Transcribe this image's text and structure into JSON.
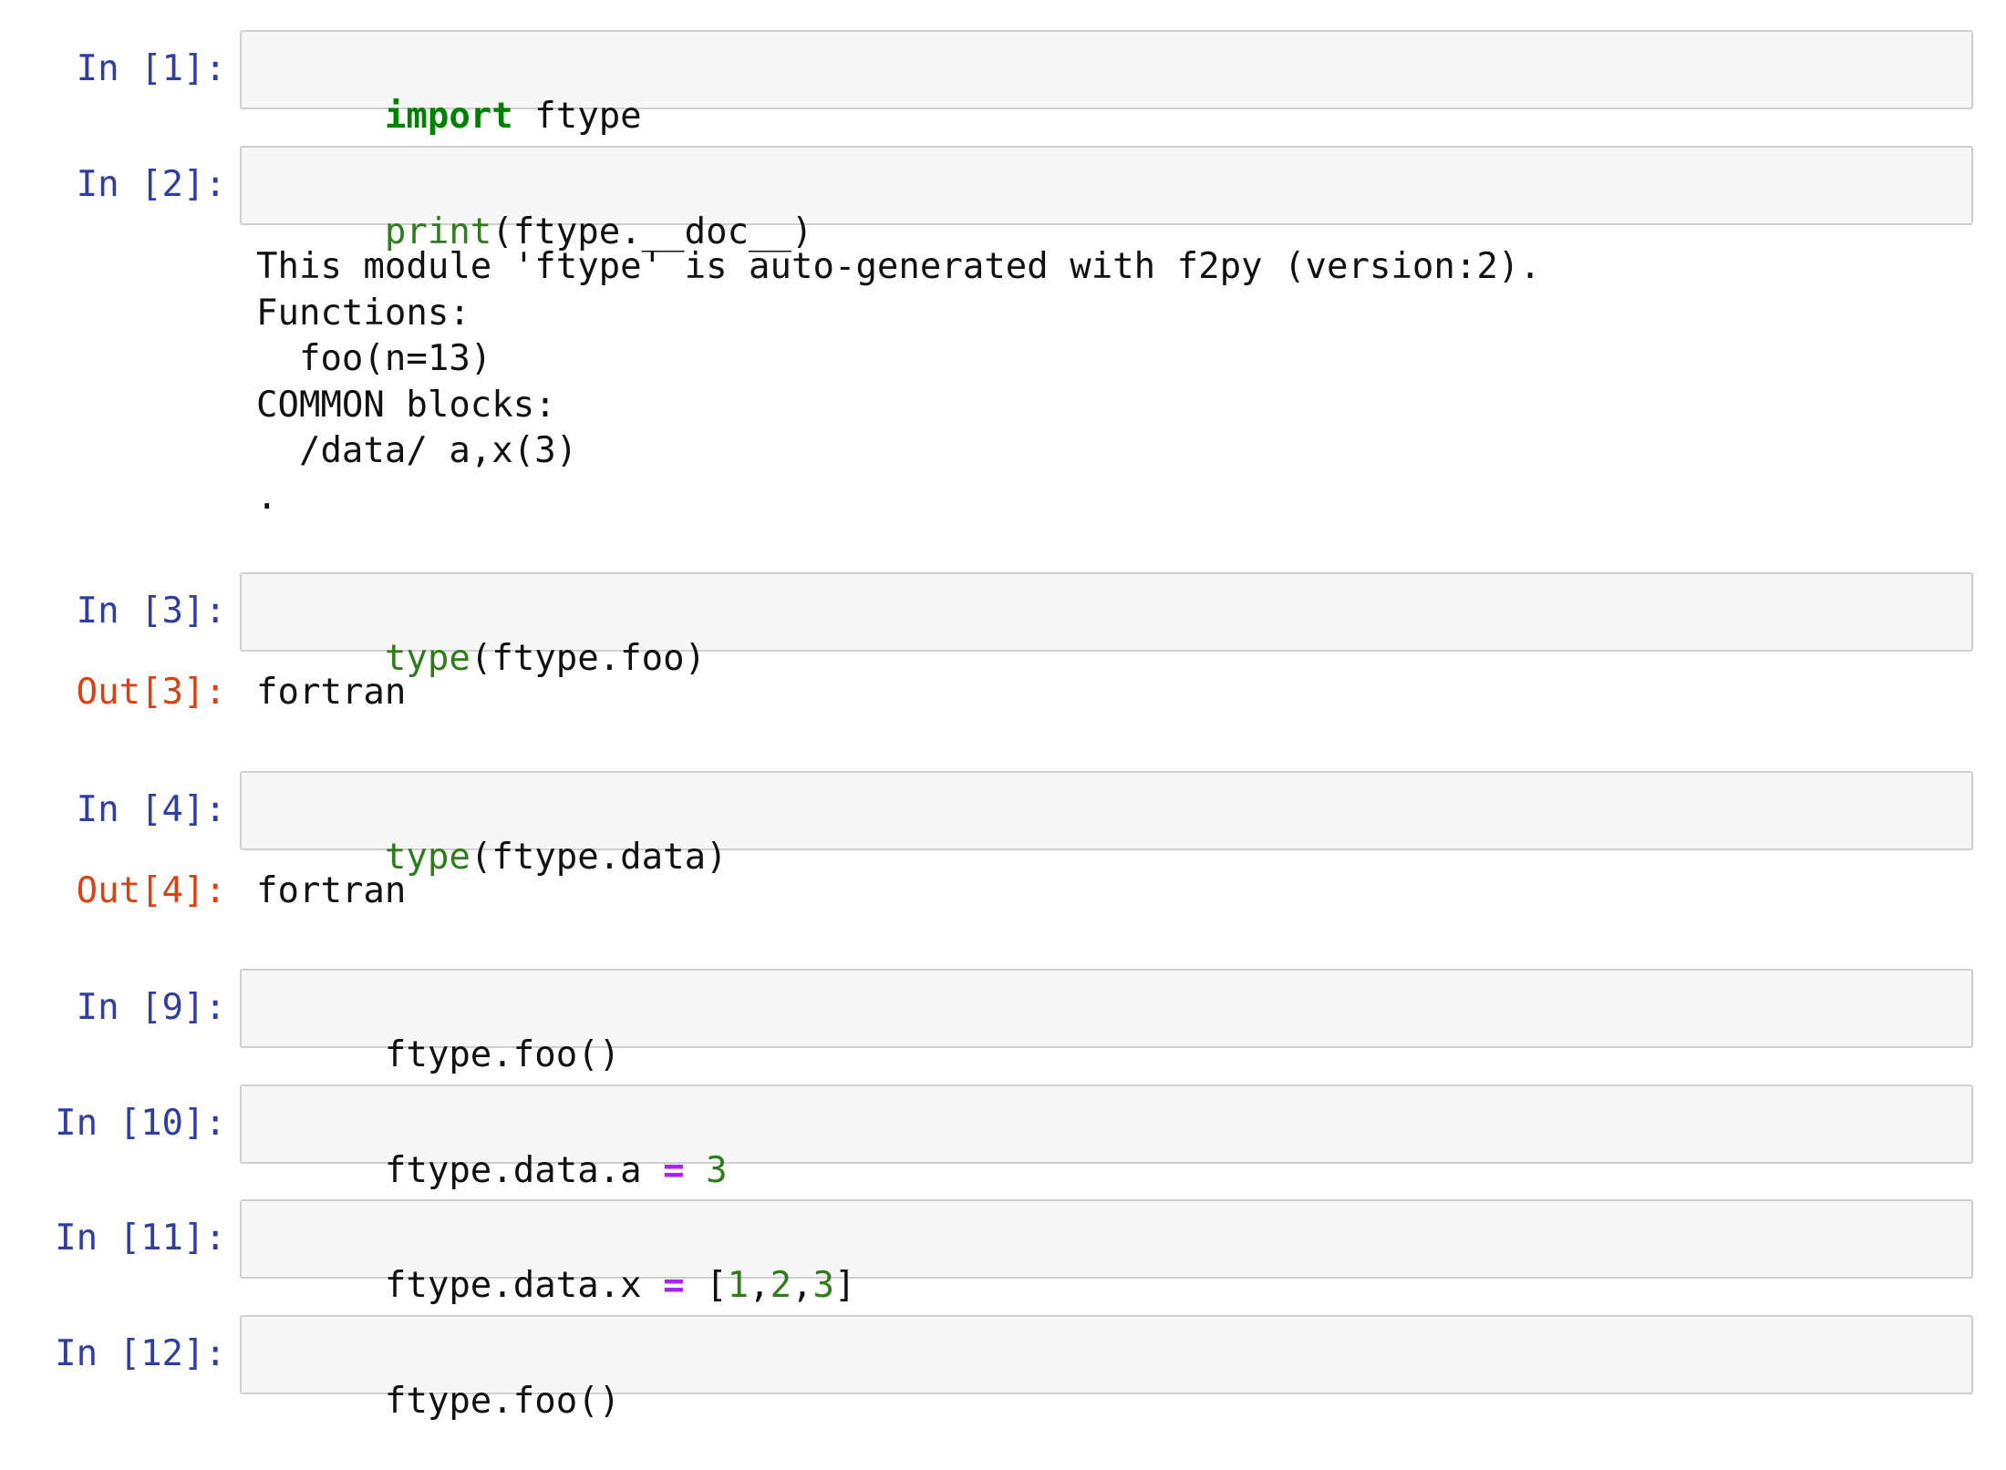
{
  "cells": [
    {
      "in_prompt": "In [1]:",
      "code": [
        {
          "t": "import",
          "k": "kw"
        },
        {
          "t": " ftype",
          "k": ""
        }
      ]
    },
    {
      "in_prompt": "In [2]:",
      "code": [
        {
          "t": "print",
          "k": "bi"
        },
        {
          "t": "(ftype.__doc__)",
          "k": ""
        }
      ],
      "stream_output": "This module 'ftype' is auto-generated with f2py (version:2).\nFunctions:\n  foo(n=13)\nCOMMON blocks:\n  /data/ a,x(3)\n."
    },
    {
      "in_prompt": "In [3]:",
      "code": [
        {
          "t": "type",
          "k": "bi"
        },
        {
          "t": "(ftype.foo)",
          "k": ""
        }
      ],
      "out_prompt": "Out[3]:",
      "result": "fortran"
    },
    {
      "in_prompt": "In [4]:",
      "code": [
        {
          "t": "type",
          "k": "bi"
        },
        {
          "t": "(ftype.data)",
          "k": ""
        }
      ],
      "out_prompt": "Out[4]:",
      "result": "fortran"
    },
    {
      "in_prompt": "In [9]:",
      "code": [
        {
          "t": "ftype.foo()",
          "k": ""
        }
      ]
    },
    {
      "in_prompt": "In [10]:",
      "code": [
        {
          "t": "ftype.data.a ",
          "k": ""
        },
        {
          "t": "=",
          "k": "op"
        },
        {
          "t": " ",
          "k": ""
        },
        {
          "t": "3",
          "k": "num"
        }
      ]
    },
    {
      "in_prompt": "In [11]:",
      "code": [
        {
          "t": "ftype.data.x ",
          "k": ""
        },
        {
          "t": "=",
          "k": "op"
        },
        {
          "t": " [",
          "k": ""
        },
        {
          "t": "1",
          "k": "num"
        },
        {
          "t": ",",
          "k": ""
        },
        {
          "t": "2",
          "k": "num"
        },
        {
          "t": ",",
          "k": ""
        },
        {
          "t": "3",
          "k": "num"
        },
        {
          "t": "]",
          "k": ""
        }
      ]
    },
    {
      "in_prompt": "In [12]:",
      "code": [
        {
          "t": "ftype.foo()",
          "k": ""
        }
      ]
    }
  ],
  "colors": {
    "in_prompt": "#303f9f",
    "out_prompt": "#d84315",
    "keyword": "#008000",
    "builtin": "#2e7d1a",
    "number": "#2e7d1a",
    "operator": "#aa22ff",
    "input_background": "#f7f7f7",
    "input_border": "#cfcfcf"
  }
}
